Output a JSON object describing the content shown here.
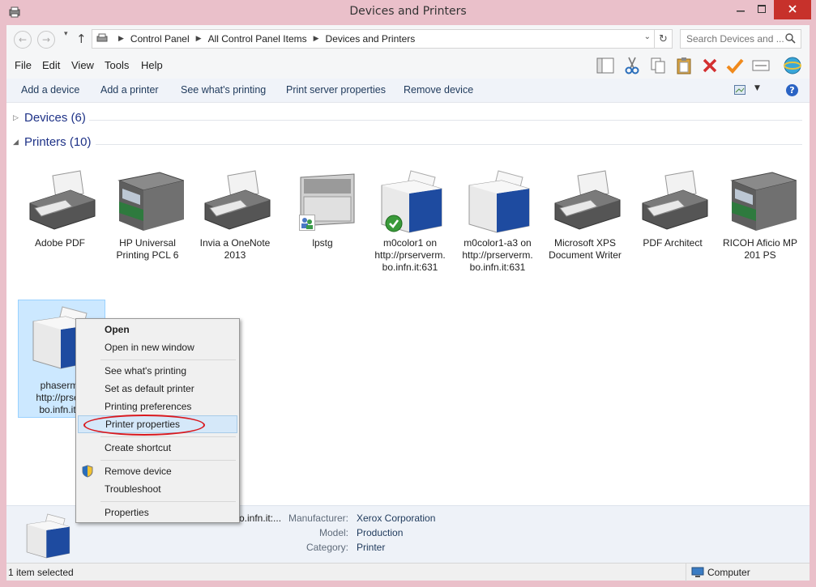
{
  "window": {
    "title": "Devices and Printers",
    "controls": {
      "minimize": "minimize-icon",
      "maximize": "maximize-icon",
      "close": "close-icon"
    }
  },
  "address": {
    "breadcrumbs": [
      "Control Panel",
      "All Control Panel Items",
      "Devices and Printers"
    ],
    "search_placeholder": "Search Devices and ..."
  },
  "menu": [
    "File",
    "Edit",
    "View",
    "Tools",
    "Help"
  ],
  "commands": [
    "Add a device",
    "Add a printer",
    "See what's printing",
    "Print server properties",
    "Remove device"
  ],
  "groups": {
    "devices": "Devices (6)",
    "printers": "Printers (10)"
  },
  "printers": [
    {
      "label_lines": [
        "Adobe PDF"
      ],
      "icon": "inkjet-printer-icon"
    },
    {
      "label_lines": [
        "HP Universal",
        "Printing PCL 6"
      ],
      "icon": "mfp-printer-icon"
    },
    {
      "label_lines": [
        "Invia a OneNote",
        "2013"
      ],
      "icon": "inkjet-printer-icon"
    },
    {
      "label_lines": [
        "lpstg"
      ],
      "icon": "laser-printer-icon",
      "badge": "shared-icon"
    },
    {
      "label_lines": [
        "m0color1 on",
        "http://prserverm.",
        "bo.infn.it:631"
      ],
      "icon": "xerox-printer-icon",
      "badge": "default-check-icon"
    },
    {
      "label_lines": [
        "m0color1-a3 on",
        "http://prserverm.",
        "bo.infn.it:631"
      ],
      "icon": "xerox-printer-icon"
    },
    {
      "label_lines": [
        "Microsoft XPS",
        "Document Writer"
      ],
      "icon": "inkjet-printer-icon"
    },
    {
      "label_lines": [
        "PDF Architect"
      ],
      "icon": "inkjet-printer-icon"
    },
    {
      "label_lines": [
        "RICOH Aficio MP",
        "201 PS"
      ],
      "icon": "mfp-printer-icon"
    },
    {
      "label_lines": [
        "phasermc",
        "http://prserv",
        "bo.infn.it:6"
      ],
      "icon": "xerox-printer-icon",
      "selected": true
    }
  ],
  "context_menu": {
    "items": [
      {
        "label": "Open",
        "bold": true
      },
      {
        "label": "Open in new window"
      },
      {
        "label": "See what's printing"
      },
      {
        "label": "Set as default printer"
      },
      {
        "label": "Printing preferences"
      },
      {
        "label": "Printer properties",
        "highlighted": true
      },
      {
        "label": "Create shortcut"
      },
      {
        "label": "Remove device",
        "icon": "uac-shield-icon"
      },
      {
        "label": "Troubleshoot"
      },
      {
        "label": "Properties"
      }
    ]
  },
  "details": {
    "name_fragment": "o.infn.it:...",
    "manufacturer_label": "Manufacturer:",
    "manufacturer": "Xerox Corporation",
    "model_label": "Model:",
    "model": "Production",
    "category_label": "Category:",
    "category": "Printer"
  },
  "status": {
    "selection": "1 item selected",
    "location": "Computer"
  },
  "colors": {
    "titlebar": "#eac0ca",
    "close_button": "#c7312b",
    "link_text": "#1e3287",
    "selection": "#cce8ff",
    "annotation": "#d9191f"
  }
}
